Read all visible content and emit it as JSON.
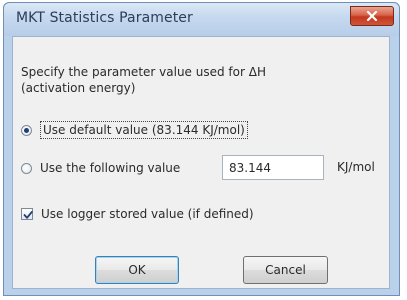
{
  "window": {
    "title": "MKT Statistics Parameter"
  },
  "description": "Specify the parameter value used for ΔH\n(activation energy)",
  "options": {
    "default_label": "Use default value (83.144 KJ/mol)",
    "default_selected": true,
    "custom_label": "Use the following value",
    "custom_selected": false,
    "custom_value": "83.144",
    "unit": "KJ/mol"
  },
  "logger_checkbox": {
    "label": "Use logger stored value (if defined)",
    "checked": true
  },
  "buttons": {
    "ok_label": "OK",
    "cancel_label": "Cancel"
  },
  "colors": {
    "title_bar": "#c5d8ee",
    "close_button": "#c2381c",
    "dialog_face": "#f0f0f0"
  },
  "icons": {
    "close": "close-icon",
    "check": "checkmark-icon"
  }
}
